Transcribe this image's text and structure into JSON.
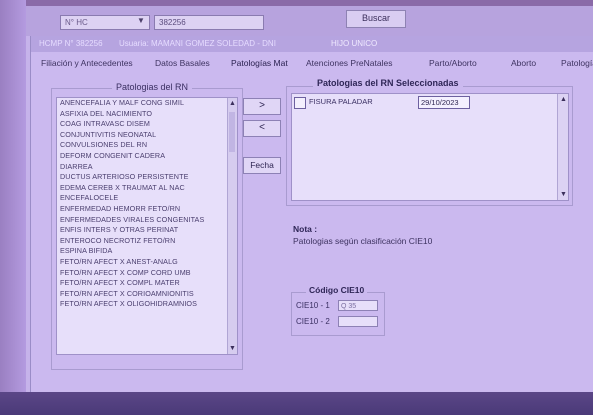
{
  "top": {
    "field_label": "N° HC",
    "field_value": "382256",
    "search_button": "Buscar"
  },
  "window": {
    "title_part1": "HCMP N° 382256",
    "title_part2": "Usuaria: MAMANI GOMEZ SOLEDAD - DNI",
    "title_part3": "HIJO UNICO"
  },
  "tabs": [
    {
      "label": "Filiación y Antecedentes"
    },
    {
      "label": "Datos Basales"
    },
    {
      "label": "Patologías Mat"
    },
    {
      "label": "Atenciones PreNatales"
    },
    {
      "label": "Parto/Aborto"
    },
    {
      "label": "Aborto"
    },
    {
      "label": "Patología"
    }
  ],
  "left_panel": {
    "legend": "Patologias del RN",
    "items": [
      "ANENCEFALIA Y MALF CONG SIMIL",
      "ASFIXIA DEL NACIMIENTO",
      "COAG INTRAVASC DISEM",
      "CONJUNTIVITIS NEONATAL",
      "CONVULSIONES DEL RN",
      "DEFORM CONGENIT CADERA",
      "DIARREA",
      "DUCTUS ARTERIOSO PERSISTENTE",
      "EDEMA CEREB X TRAUMAT AL NAC",
      "ENCEFALOCELE",
      "ENFERMEDAD HEMORR FETO/RN",
      "ENFERMEDADES VIRALES CONGENITAS",
      "ENFIS INTERS Y OTRAS PERINAT",
      "ENTEROCO NECROTIZ FETO/RN",
      "ESPINA BIFIDA",
      "FETO/RN AFECT X ANEST-ANALG",
      "FETO/RN AFECT X COMP CORD UMB",
      "FETO/RN AFECT X COMPL MATER",
      "FETO/RN AFECT X CORIOAMNIONITIS",
      "FETO/RN AFECT X OLIGOHIDRAMNIOS"
    ]
  },
  "buttons": {
    "add": ">",
    "remove": "<",
    "date": "Fecha"
  },
  "right_panel": {
    "legend": "Patologias del RN Seleccionadas",
    "selected": [
      {
        "name": "FISURA PALADAR",
        "date": "29/10/2023"
      }
    ]
  },
  "note": {
    "title": "Nota :",
    "text": "Patologias según clasificación CIE10"
  },
  "cie": {
    "legend": "Código CIE10",
    "label1": "CIE10 - 1",
    "value1": "Q 35",
    "label2": "CIE10 - 2",
    "value2": ""
  }
}
